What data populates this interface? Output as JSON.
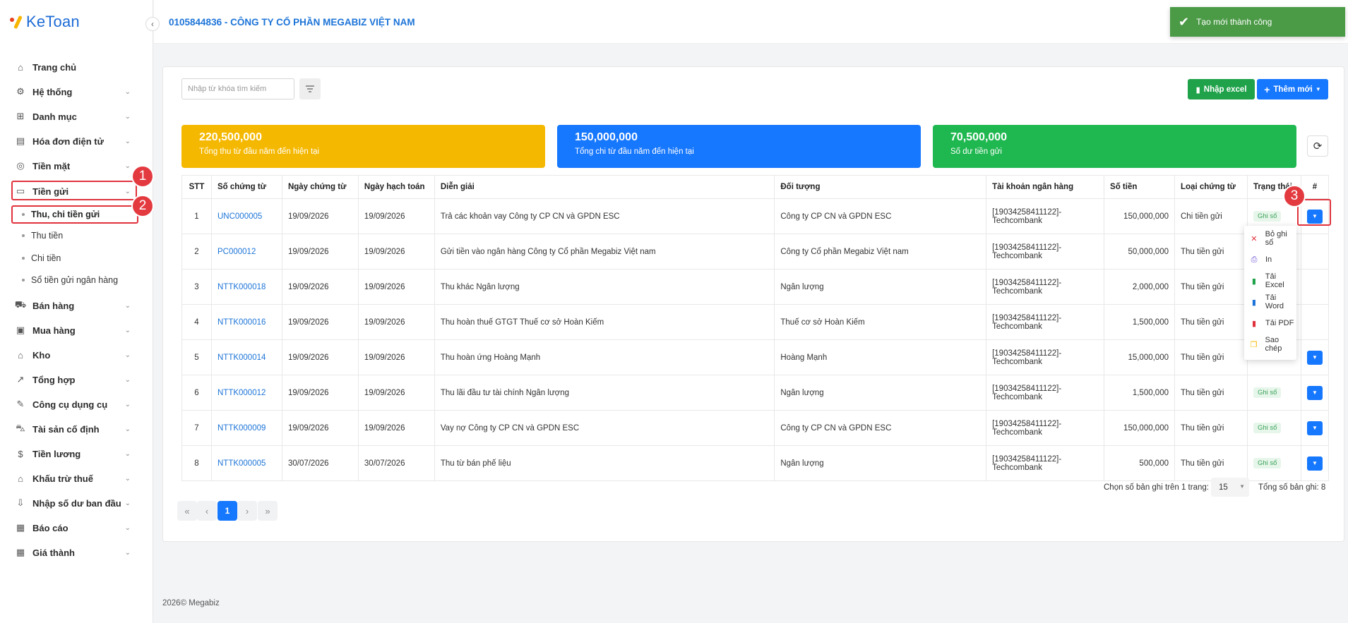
{
  "app": {
    "logo_text": "KeToan",
    "collapse_icon": "chevron-left-icon"
  },
  "header": {
    "company": "0105844836 - CÔNG TY CỔ PHẦN MEGABIZ VIỆT NAM"
  },
  "toast": {
    "message": "Tạo mới thành công",
    "icon": "check-icon"
  },
  "sidebar": {
    "items": [
      {
        "label": "Trang chủ",
        "icon": "home-icon"
      },
      {
        "label": "Hệ thống",
        "icon": "gear-icon"
      },
      {
        "label": "Danh mục",
        "icon": "grid-icon"
      },
      {
        "label": "Hóa đơn điện tử",
        "icon": "invoice-icon"
      },
      {
        "label": "Tiền mặt",
        "icon": "cash-icon"
      },
      {
        "label": "Tiền gửi",
        "icon": "card-icon"
      },
      {
        "label": "Bán hàng",
        "icon": "cart-icon"
      },
      {
        "label": "Mua hàng",
        "icon": "bag-icon"
      },
      {
        "label": "Kho",
        "icon": "warehouse-icon"
      },
      {
        "label": "Tổng hợp",
        "icon": "chart-icon"
      },
      {
        "label": "Công cụ dụng cụ",
        "icon": "tools-icon"
      },
      {
        "label": "Tài sản cố định",
        "icon": "car-icon"
      },
      {
        "label": "Tiền lương",
        "icon": "salary-icon"
      },
      {
        "label": "Khấu trừ thuế",
        "icon": "bank-icon"
      },
      {
        "label": "Nhập số dư ban đầu",
        "icon": "import-icon"
      },
      {
        "label": "Báo cáo",
        "icon": "report-icon"
      },
      {
        "label": "Giá thành",
        "icon": "calculator-icon"
      }
    ],
    "sub_items": [
      {
        "label": "Thu, chi tiền gửi"
      },
      {
        "label": "Thu tiền"
      },
      {
        "label": "Chi tiền"
      },
      {
        "label": "Sổ tiền gửi ngân hàng"
      }
    ]
  },
  "annotations": {
    "step1": "1",
    "step2": "2",
    "step3": "3"
  },
  "toolbar": {
    "search_placeholder": "Nhập từ khóa tìm kiếm",
    "filter_icon": "filter-icon",
    "import_excel_label": "Nhập excel",
    "add_new_label": "Thêm mới",
    "refresh_icon": "refresh-icon"
  },
  "stats": [
    {
      "value": "220,500,000",
      "label": "Tổng thu từ đầu năm đến hiện tại",
      "color": "#f5b800"
    },
    {
      "value": "150,000,000",
      "label": "Tổng chi từ đầu năm đến hiện tại",
      "color": "#1677ff"
    },
    {
      "value": "70,500,000",
      "label": "Số dư tiền gửi",
      "color": "#1fb850"
    }
  ],
  "table": {
    "headers": [
      "STT",
      "Số chứng từ",
      "Ngày chứng từ",
      "Ngày hạch toán",
      "Diễn giải",
      "Đối tượng",
      "Tài khoản ngân hàng",
      "Số tiền",
      "Loại chứng từ",
      "Trạng thái",
      "#"
    ],
    "rows": [
      {
        "stt": "1",
        "doc": "UNC000005",
        "doc_date": "19/09/2026",
        "post_date": "19/09/2026",
        "desc": "Trả các khoản vay Công ty CP CN và GPDN ESC",
        "party": "Công ty CP CN và GPDN ESC",
        "bank": "[19034258411122]-\nTechcombank",
        "amount": "150,000,000",
        "type": "Chi tiền gửi",
        "status": "Ghi sổ"
      },
      {
        "stt": "2",
        "doc": "PC000012",
        "doc_date": "19/09/2026",
        "post_date": "19/09/2026",
        "desc": "Gửi tiền vào ngân hàng Công ty Cổ phần Megabiz Việt nam",
        "party": "Công ty Cổ phần Megabiz Việt nam",
        "bank": "[19034258411122]-\nTechcombank",
        "amount": "50,000,000",
        "type": "Thu tiền gửi",
        "status": ""
      },
      {
        "stt": "3",
        "doc": "NTTK000018",
        "doc_date": "19/09/2026",
        "post_date": "19/09/2026",
        "desc": "Thu khác Ngân lượng",
        "party": "Ngân lượng",
        "bank": "[19034258411122]-\nTechcombank",
        "amount": "2,000,000",
        "type": "Thu tiền gửi",
        "status": ""
      },
      {
        "stt": "4",
        "doc": "NTTK000016",
        "doc_date": "19/09/2026",
        "post_date": "19/09/2026",
        "desc": "Thu hoàn thuế GTGT Thuế cơ sở Hoàn Kiếm",
        "party": "Thuế cơ sở Hoàn Kiếm",
        "bank": "[19034258411122]-\nTechcombank",
        "amount": "1,500,000",
        "type": "Thu tiền gửi",
        "status": ""
      },
      {
        "stt": "5",
        "doc": "NTTK000014",
        "doc_date": "19/09/2026",
        "post_date": "19/09/2026",
        "desc": "Thu hoàn ứng Hoàng Mạnh",
        "party": "Hoàng Mạnh",
        "bank": "[19034258411122]-\nTechcombank",
        "amount": "15,000,000",
        "type": "Thu tiền gửi",
        "status": ""
      },
      {
        "stt": "6",
        "doc": "NTTK000012",
        "doc_date": "19/09/2026",
        "post_date": "19/09/2026",
        "desc": "Thu lãi đầu tư tài chính Ngân lượng",
        "party": "Ngân lượng",
        "bank": "[19034258411122]-\nTechcombank",
        "amount": "1,500,000",
        "type": "Thu tiền gửi",
        "status": "Ghi sổ"
      },
      {
        "stt": "7",
        "doc": "NTTK000009",
        "doc_date": "19/09/2026",
        "post_date": "19/09/2026",
        "desc": "Vay nợ Công ty CP CN và GPDN ESC",
        "party": "Công ty CP CN và GPDN ESC",
        "bank": "[19034258411122]-\nTechcombank",
        "amount": "150,000,000",
        "type": "Thu tiền gửi",
        "status": "Ghi sổ"
      },
      {
        "stt": "8",
        "doc": "NTTK000005",
        "doc_date": "30/07/2026",
        "post_date": "30/07/2026",
        "desc": "Thu từ bán phế liệu",
        "party": "Ngân lượng",
        "bank": "[19034258411122]-\nTechcombank",
        "amount": "500,000",
        "type": "Thu tiền gửi",
        "status": "Ghi sổ"
      }
    ]
  },
  "dropdown": {
    "items": [
      {
        "label": "Bỏ ghi sổ",
        "icon": "close-icon",
        "color": "#e0323c"
      },
      {
        "label": "In",
        "icon": "printer-icon",
        "color": "#6a4fd8"
      },
      {
        "label": "Tải Excel",
        "icon": "excel-icon",
        "color": "#1fa24a"
      },
      {
        "label": "Tải Word",
        "icon": "word-icon",
        "color": "#1c74d8"
      },
      {
        "label": "Tải PDF",
        "icon": "pdf-icon",
        "color": "#e0323c"
      },
      {
        "label": "Sao chép",
        "icon": "copy-icon",
        "color": "#f5b800"
      }
    ]
  },
  "pagination": {
    "first_icon": "«",
    "prev_icon": "‹",
    "current": "1",
    "next_icon": "›",
    "last_icon": "»",
    "per_page_label": "Chọn số bản ghi trên 1 trang:",
    "per_page": "15",
    "total_label": "Tổng số bản ghi: 8"
  },
  "footer": {
    "text": "2026© Megabiz"
  }
}
